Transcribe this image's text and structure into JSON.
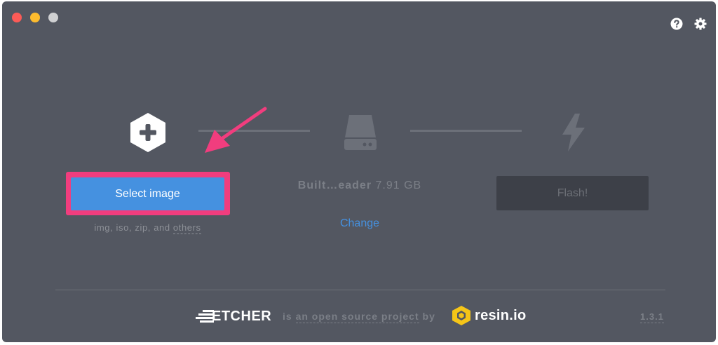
{
  "window": {
    "controls": [
      "close",
      "minimize",
      "maximize"
    ],
    "header_icons": [
      "help-icon",
      "settings-icon"
    ]
  },
  "steps": {
    "image": {
      "icon": "plus-hexagon-icon",
      "button_label": "Select image",
      "formats_prefix": "img, iso, zip, and",
      "formats_link": "others"
    },
    "drive": {
      "icon": "hard-drive-icon",
      "name": "Built…eader",
      "size": "7.91 GB",
      "change_label": "Change"
    },
    "flash": {
      "icon": "lightning-bolt-icon",
      "button_label": "Flash!"
    }
  },
  "footer": {
    "etcher_label": "ETCHER",
    "tagline_prefix": "is",
    "tagline_link": "an open source project",
    "tagline_suffix": "by",
    "resin_label": "resin.io",
    "version": "1.3.1"
  },
  "colors": {
    "background": "#535761",
    "accent": "#4591e0",
    "highlight": "#f13d7e"
  }
}
